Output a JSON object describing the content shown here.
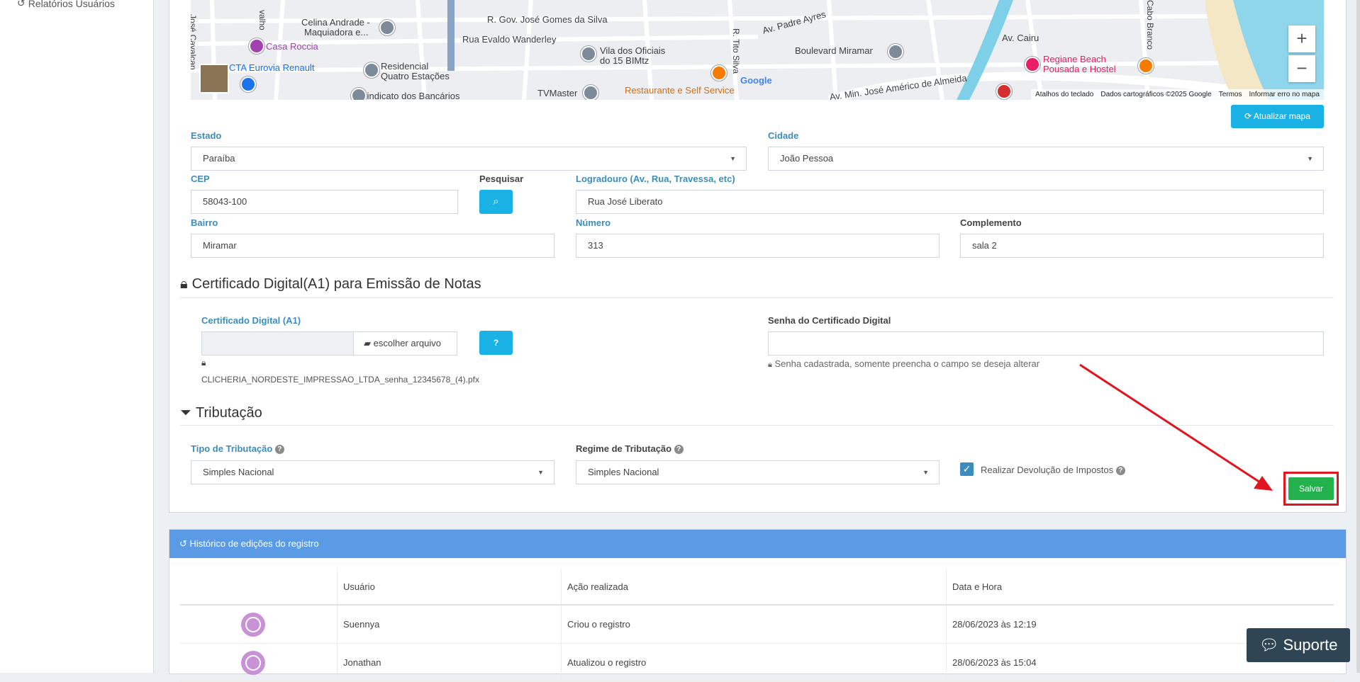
{
  "sidebar": {
    "items": [
      {
        "label": "Relatórios Usuários"
      }
    ]
  },
  "map": {
    "labels": [
      "José Cavalcan",
      "valho",
      "Celina Andrade -",
      "Maquiadora e...",
      "R. Gov. José Gomes da Silva",
      "Rua Evaldo Wanderley",
      "Casa Roccia",
      "CTA Eurovia Renault",
      "Residencial",
      "Quatro Estações",
      "Vila dos Oficiais",
      "do 15 BIMtz",
      "Sindicato dos Bancários",
      "TVMaster",
      "Restaurante e Self Service",
      "R. Tito Silva",
      "Av. Padre Ayres",
      "Boulevard Miramar",
      "Av. Min. José Américo de Almeida",
      "Av. Cairu",
      "Regiane Beach",
      "Pousada e Hostel",
      "Cabo Branco",
      "Google"
    ],
    "zoom_in": "+",
    "zoom_out": "−",
    "footer": [
      "Atalhos do teclado",
      "Dados cartográficos ©2025 Google",
      "Termos",
      "Informar erro no mapa"
    ]
  },
  "update_map_button": "Atualizar mapa",
  "address": {
    "estado_label": "Estado",
    "estado_value": "Paraíba",
    "cidade_label": "Cidade",
    "cidade_value": "João Pessoa",
    "cep_label": "CEP",
    "cep_value": "58043-100",
    "pesquisar_label": "Pesquisar",
    "logradouro_label": "Logradouro (Av., Rua, Travessa, etc)",
    "logradouro_value": "Rua José Liberato",
    "bairro_label": "Bairro",
    "bairro_value": "Miramar",
    "numero_label": "Número",
    "numero_value": "313",
    "complemento_label": "Complemento",
    "complemento_value": "sala 2"
  },
  "certificate": {
    "title": "Certificado Digital(A1) para Emissão de Notas",
    "file_label": "Certificado Digital (A1)",
    "choose_file": "escolher arquivo",
    "filename": "CLICHERIA_NORDESTE_IMPRESSAO_LTDA_senha_12345678_(4).pfx",
    "password_label": "Senha do Certificado Digital",
    "password_value": "",
    "password_hint": "Senha cadastrada, somente preencha o campo se deseja alterar"
  },
  "tax": {
    "title": "Tributação",
    "tipo_label": "Tipo de Tributação",
    "tipo_value": "Simples Nacional",
    "regime_label": "Regime de Tributação",
    "regime_value": "Simples Nacional",
    "devolucao_label": "Realizar Devolução de Impostos",
    "devolucao_checked": true,
    "save_button": "Salvar"
  },
  "history": {
    "title": "Histórico de edições do registro",
    "columns": [
      "Usuário",
      "Ação realizada",
      "Data e Hora"
    ],
    "rows": [
      {
        "user": "Suennya",
        "action": "Criou o registro",
        "datetime": "28/06/2023 às 12:19"
      },
      {
        "user": "Jonathan",
        "action": "Atualizou o registro",
        "datetime": "28/06/2023 às 15:04"
      }
    ]
  },
  "support_button": "Suporte",
  "colors": {
    "accent": "#3c8dbc",
    "info": "#1ab1e4",
    "success": "#22b14c",
    "annotation": "#e0151f",
    "history_header": "#5b9be6"
  }
}
